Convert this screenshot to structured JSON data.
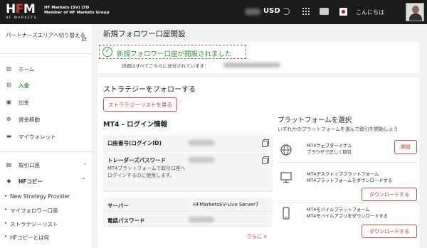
{
  "header": {
    "logo_text": "HFM",
    "logo_sub": "HF MARKETS",
    "company_line1": "HF Markets (SV) LTD",
    "company_line2": "Member of HF Markets Group",
    "currency": "USD",
    "greeting": "こんにちは"
  },
  "sidebar": {
    "partner_switch": "パートナーズエリアへ切り替える",
    "items": [
      {
        "label": "ホーム",
        "icon": "chart-bar-icon"
      },
      {
        "label": "入金",
        "icon": "deposit-icon"
      },
      {
        "label": "出金",
        "icon": "withdraw-icon"
      },
      {
        "label": "資金移動",
        "icon": "transfer-icon"
      },
      {
        "label": "マイウォレット",
        "icon": "wallet-icon"
      },
      {
        "label": "取引口座",
        "icon": "accounts-icon"
      },
      {
        "label": "HFコピー",
        "icon": "hfcopy-icon"
      }
    ],
    "sub_items": [
      "New Strategy Provider",
      "マイフォロワー口座",
      "ストラテジーリスト",
      "HFコピーとは何"
    ]
  },
  "main": {
    "page_title": "新規フォロワー口座開設",
    "success_message": "新規フォロワー口座が開設されました",
    "details_text": "詳細はすべてこちらに送付されています：",
    "strategy_title": "ストラテジーをフォローする",
    "strategy_button": "ストラテジーリストを見る",
    "login_title": "MT4 - ログイン情報",
    "rows": {
      "account_label": "口座番号(ログインID)",
      "trader_pw_label": "トレーダーズパスワード",
      "trader_pw_desc": "MT4プラットフォームで取引口座へログインするのに使用します。",
      "server_label": "サーバー",
      "server_value": "HFMarketsSV-Live Server7",
      "phone_pw_label": "電話パスワード"
    },
    "more_link": "さらに ∨",
    "platform": {
      "title": "プラットフォームを選択",
      "subtitle": "いずれかのプラットフォームを選んで取引を開始しよう",
      "items": [
        {
          "line1": "MT4ウェブターミナル",
          "line2": "ブラウザで正しく取引",
          "button": "開設"
        },
        {
          "line1": "MT4デスクトッププラットフォーム",
          "line2": "MT4プラットフォームをダウンロードする",
          "button": "ダウンロードする"
        },
        {
          "line1": "MT4モバイルプラットフォーム",
          "line2": "MT4モバイルアプリをダウンロードする",
          "button": "ダウンロードする"
        }
      ]
    }
  }
}
